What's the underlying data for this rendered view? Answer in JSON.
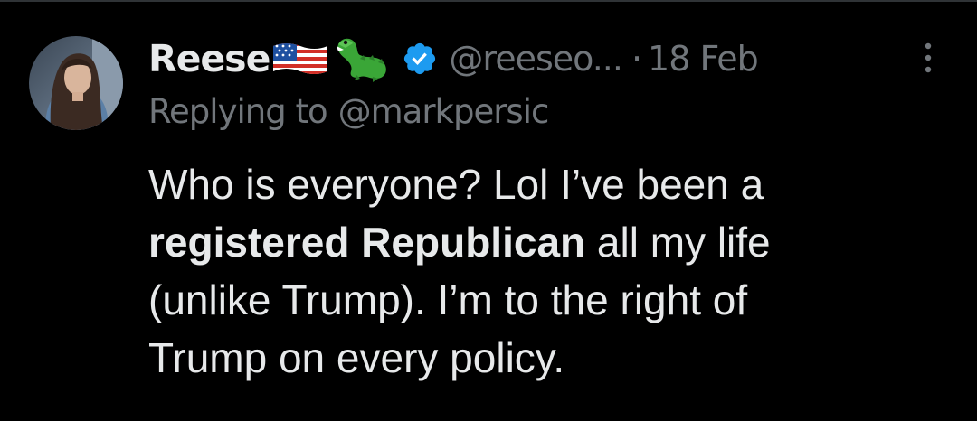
{
  "tweet": {
    "display_name": "Reese",
    "handle": "@reeseo...",
    "separator": "·",
    "timestamp": "18 Feb",
    "replying_label": "Replying to",
    "replying_handle": "@markpersic",
    "body": {
      "line1": "Who is everyone? Lol I’ve been a",
      "line2_bold": "registered Republican",
      "line2_rest": " all my life",
      "line3": "(unlike Trump). I’m to the right of",
      "line4": "Trump on every policy."
    },
    "icons": {
      "flag": "us-flag-emoji",
      "crocodile": "crocodile-emoji",
      "verified": "verified-badge-icon",
      "more": "more-options-icon"
    }
  },
  "colors": {
    "background": "#000000",
    "primary_text": "#e7e9ea",
    "secondary_text": "#71767b",
    "verified_blue": "#1d9bf0",
    "divider": "#2f3336"
  }
}
